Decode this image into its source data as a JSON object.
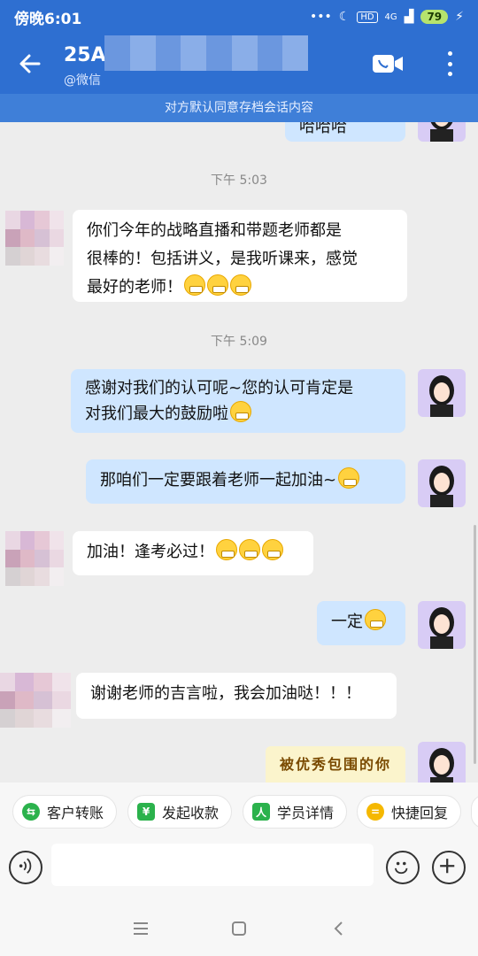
{
  "status_bar": {
    "time": "傍晚6:01",
    "dots": "•••",
    "hd": "HD",
    "signal": "4G",
    "battery": "79",
    "charge": "⚡"
  },
  "header": {
    "title": "25A",
    "subtitle": "@微信",
    "notice": "对方默认同意存档会话内容"
  },
  "messages": {
    "partial_top": "哈哈哈",
    "time1": "下午 5:03",
    "m1_line1": "你们今年的战略直播和带题老师都是",
    "m1_line2": "很棒的！包括讲义，是我听课来，感觉",
    "m1_line3": "最好的老师！",
    "time2": "下午 5:09",
    "m2_line1": "感谢对我们的认可呢~您的认可肯定是",
    "m2_line2": "对我们最大的鼓励啦",
    "m3": "那咱们一定要跟着老师一起加油~",
    "m4": "加油！逢考必过！",
    "m5": "一定",
    "m6": "谢谢老师的吉言啦，我会加油哒！！！",
    "sticker": "被优秀包围的你"
  },
  "quick_actions": [
    {
      "label": "客户转账",
      "color": "#2bb24c",
      "icon": "⇆"
    },
    {
      "label": "发起收款",
      "color": "#2bb24c",
      "icon": "¥"
    },
    {
      "label": "学员详情",
      "color": "#2bb24c",
      "icon": "人"
    },
    {
      "label": "快捷回复",
      "color": "#f5b800",
      "icon": "="
    }
  ]
}
